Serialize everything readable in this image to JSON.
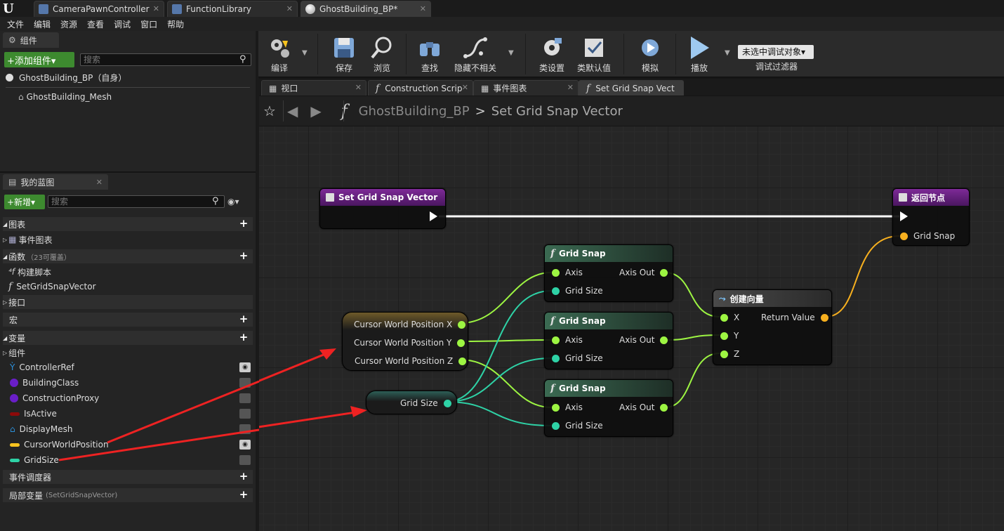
{
  "title_tabs": [
    {
      "label": "CameraPawnController",
      "close": "✕"
    },
    {
      "label": "FunctionLibrary",
      "close": "✕"
    },
    {
      "label": "GhostBuilding_BP*",
      "close": "✕"
    }
  ],
  "menu": [
    "文件",
    "编辑",
    "资源",
    "查看",
    "调试",
    "窗口",
    "帮助"
  ],
  "components_panel": {
    "tab_label": "组件",
    "add_button": "+添加组件▾",
    "search_placeholder": "搜索",
    "root_item": "GhostBuilding_BP（自身）",
    "child_item": "GhostBuilding_Mesh"
  },
  "my_blueprint": {
    "tab_label": "我的蓝图",
    "new_button": "+新增▾",
    "search_placeholder": "搜索",
    "categories": {
      "graphs": "图表",
      "event_graph": "事件图表",
      "functions": "函数",
      "functions_note": "（23可覆盖）",
      "construction_script": "构建脚本",
      "set_grid_func": "SetGridSnapVector",
      "interfaces": "接口",
      "macros": "宏",
      "variables": "变量",
      "components_cat": "组件",
      "dispatchers": "事件调度器",
      "local_vars": "局部变量",
      "local_vars_note": "(SetGridSnapVector)"
    },
    "variables": [
      {
        "name": "ControllerRef",
        "color": "#2c8fd8",
        "visible": true
      },
      {
        "name": "BuildingClass",
        "color": "#6a1ec8",
        "visible": false
      },
      {
        "name": "ConstructionProxy",
        "color": "#6a1ec8",
        "visible": false
      },
      {
        "name": "IsActive",
        "color": "#8c0a0a",
        "visible": false
      },
      {
        "name": "DisplayMesh",
        "color": "#2c8fd8",
        "visible": false
      },
      {
        "name": "CursorWorldPosition",
        "color": "#f7c31f",
        "visible": true
      },
      {
        "name": "GridSize",
        "color": "#2ed2a6",
        "visible": false
      }
    ]
  },
  "toolbar": {
    "compile": "编译",
    "save": "保存",
    "browse": "浏览",
    "find": "查找",
    "hide": "隐藏不相关",
    "class_settings": "类设置",
    "class_defaults": "类默认值",
    "simulate": "模拟",
    "play": "播放",
    "debug_object": "未选中调试对象▾",
    "debug_filter": "调试过滤器"
  },
  "editor_tabs": [
    {
      "label": "视口",
      "close": "✕"
    },
    {
      "label": "Construction Scrip",
      "close": "✕"
    },
    {
      "label": "事件图表",
      "close": "✕"
    },
    {
      "label": "Set Grid Snap Vect",
      "close": ""
    }
  ],
  "breadcrumb": {
    "root": "GhostBuilding_BP",
    "separator": ">",
    "current": "Set Grid Snap Vector"
  },
  "graph": {
    "entry_node": "Set Grid Snap Vector",
    "return_node": "返回节点",
    "return_pin": "Grid Snap",
    "cursor_pins": [
      "Cursor World Position X",
      "Cursor World Position Y",
      "Cursor World Position Z"
    ],
    "grid_size_node": "Grid Size",
    "grid_snap_title": "Grid Snap",
    "axis_label": "Axis",
    "grid_size_pin": "Grid Size",
    "axis_out": "Axis Out",
    "make_vector": "创建向量",
    "mv_pins": [
      "X",
      "Y",
      "Z"
    ],
    "return_value": "Return Value"
  }
}
